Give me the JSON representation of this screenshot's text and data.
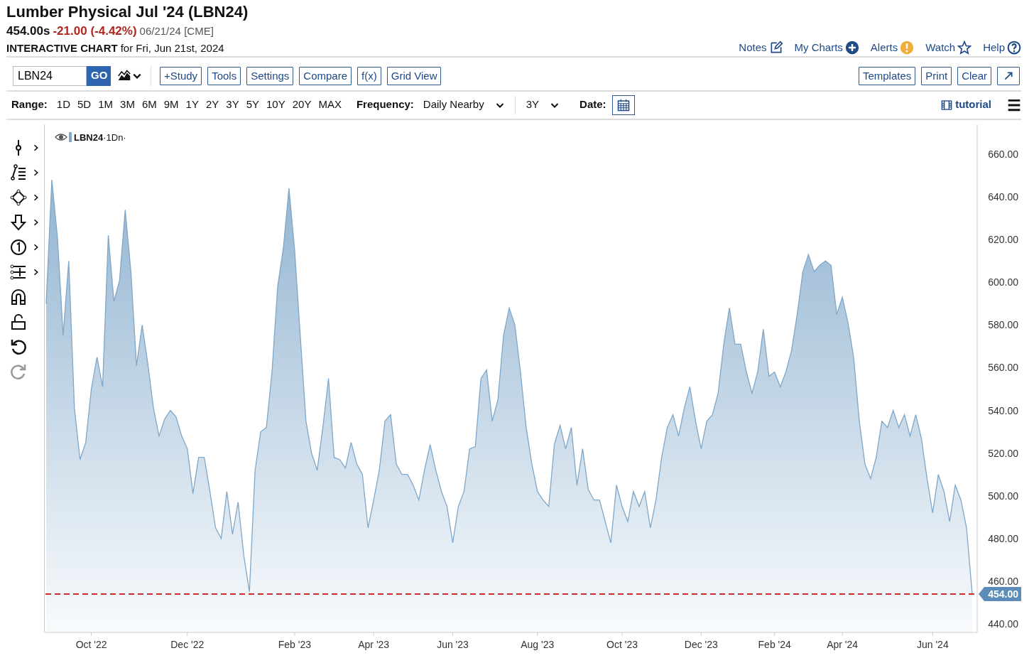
{
  "header": {
    "title": "Lumber Physical Jul '24 (LBN24)",
    "price": "454.00s",
    "change": "-21.00 (-4.42%)",
    "date": "06/21/24 [CME]",
    "chart_label": "INTERACTIVE CHART",
    "chart_for": "for Fri, Jun 21st, 2024"
  },
  "header_links": [
    {
      "label": "Notes",
      "kind": "notes"
    },
    {
      "label": "My Charts",
      "kind": "add"
    },
    {
      "label": "Alerts",
      "kind": "alert"
    },
    {
      "label": "Watch",
      "kind": "star"
    },
    {
      "label": "Help",
      "kind": "help"
    }
  ],
  "toolbar": {
    "symbol": "LBN24",
    "go": "GO",
    "buttons": [
      "+Study",
      "Tools",
      "Settings",
      "Compare",
      "f(x)",
      "Grid View"
    ],
    "right_buttons": [
      "Templates",
      "Print",
      "Clear"
    ]
  },
  "range": {
    "label": "Range:",
    "options": [
      "1D",
      "5D",
      "1M",
      "3M",
      "6M",
      "9M",
      "1Y",
      "2Y",
      "3Y",
      "5Y",
      "10Y",
      "20Y",
      "MAX"
    ],
    "frequency_label": "Frequency:",
    "frequency": "Daily Nearby",
    "period": "3Y",
    "date_label": "Date:",
    "tutorial": "tutorial"
  },
  "tools": [
    {
      "kind": "crosshair",
      "has_menu": true,
      "disabled": false
    },
    {
      "kind": "trendline",
      "has_menu": true,
      "disabled": false
    },
    {
      "kind": "shape",
      "has_menu": true,
      "disabled": false
    },
    {
      "kind": "arrow",
      "has_menu": true,
      "disabled": false
    },
    {
      "kind": "number",
      "has_menu": true,
      "disabled": false
    },
    {
      "kind": "fib",
      "has_menu": true,
      "disabled": false
    },
    {
      "kind": "magnet",
      "has_menu": false,
      "disabled": false
    },
    {
      "kind": "lock",
      "has_menu": false,
      "disabled": false
    },
    {
      "kind": "undo",
      "has_menu": false,
      "disabled": false
    },
    {
      "kind": "redo",
      "has_menu": false,
      "disabled": true
    }
  ],
  "chart": {
    "legend_interval": "·1Dn·",
    "chart_data": {
      "type": "area",
      "categories": [
        null,
        null,
        null,
        null,
        null,
        null,
        null,
        null,
        "Oct '22",
        null,
        null,
        null,
        null,
        null,
        null,
        null,
        null,
        null,
        null,
        null,
        null,
        null,
        null,
        null,
        null,
        "Dec '22",
        null,
        null,
        null,
        null,
        null,
        null,
        null,
        null,
        null,
        null,
        null,
        null,
        null,
        null,
        null,
        null,
        null,
        null,
        "Feb '23",
        null,
        null,
        null,
        null,
        null,
        null,
        null,
        null,
        null,
        null,
        null,
        null,
        null,
        "Apr '23",
        null,
        null,
        null,
        null,
        null,
        null,
        null,
        null,
        null,
        null,
        null,
        null,
        null,
        "Jun '23",
        null,
        null,
        null,
        null,
        null,
        null,
        null,
        null,
        null,
        null,
        null,
        null,
        null,
        null,
        "Aug '23",
        null,
        null,
        null,
        null,
        null,
        null,
        null,
        null,
        null,
        null,
        null,
        null,
        null,
        null,
        "Oct '23",
        null,
        null,
        null,
        null,
        null,
        null,
        null,
        null,
        null,
        null,
        null,
        null,
        null,
        "Dec '23",
        null,
        null,
        null,
        null,
        null,
        null,
        null,
        null,
        null,
        null,
        null,
        null,
        "Feb '24",
        null,
        null,
        null,
        null,
        null,
        null,
        null,
        null,
        null,
        null,
        null,
        "Apr '24",
        null,
        null,
        null,
        null,
        null,
        null,
        null,
        null,
        null,
        null,
        null,
        null,
        null,
        null,
        null,
        "Jun '24",
        null,
        null,
        null,
        null,
        null,
        null,
        null
      ],
      "series": [
        {
          "name": "LBN24",
          "color": "#7fa7c9",
          "values": [
            590,
            648,
            621,
            575,
            610,
            541,
            517,
            525,
            550,
            565,
            551,
            622,
            591,
            601,
            634,
            605,
            561,
            580,
            562,
            541,
            528,
            536,
            540,
            537,
            528,
            522,
            501,
            518,
            518,
            502,
            485,
            480,
            502,
            482,
            497,
            472,
            455,
            512,
            530,
            532,
            558,
            598,
            616,
            644,
            615,
            575,
            535,
            520,
            512,
            532,
            555,
            518,
            517,
            513,
            525,
            515,
            510,
            485,
            498,
            512,
            535,
            538,
            515,
            510,
            510,
            505,
            498,
            512,
            524,
            512,
            502,
            495,
            478,
            495,
            502,
            522,
            523,
            555,
            559,
            535,
            545,
            575,
            588,
            580,
            558,
            532,
            515,
            502,
            498,
            495,
            524,
            533,
            522,
            532,
            505,
            522,
            503,
            498,
            498,
            488,
            478,
            505,
            495,
            488,
            502,
            495,
            502,
            485,
            498,
            518,
            532,
            538,
            528,
            541,
            551,
            535,
            522,
            535,
            538,
            548,
            571,
            588,
            571,
            571,
            558,
            548,
            558,
            578,
            556,
            558,
            551,
            558,
            568,
            585,
            605,
            613,
            605,
            608,
            610,
            608,
            585,
            593,
            581,
            565,
            535,
            515,
            508,
            518,
            535,
            532,
            540,
            532,
            538,
            528,
            538,
            527,
            508,
            492,
            510,
            502,
            488,
            505,
            498,
            485,
            454
          ]
        }
      ],
      "ylim": [
        436,
        674
      ],
      "ref_lines": [
        {
          "axis": "y",
          "value": 454,
          "label": "454.00",
          "color": "#cc2b2b"
        }
      ],
      "yticks": [
        {
          "value": 440,
          "label": "440.00"
        },
        {
          "value": 460,
          "label": "460.00"
        },
        {
          "value": 480,
          "label": "480.00"
        },
        {
          "value": 500,
          "label": "500.00"
        },
        {
          "value": 520,
          "label": "520.00"
        },
        {
          "value": 540,
          "label": "540.00"
        },
        {
          "value": 560,
          "label": "560.00"
        },
        {
          "value": 580,
          "label": "580.00"
        },
        {
          "value": 600,
          "label": "600.00"
        },
        {
          "value": 620,
          "label": "620.00"
        },
        {
          "value": 640,
          "label": "640.00"
        },
        {
          "value": 660,
          "label": "660.00"
        }
      ]
    }
  }
}
